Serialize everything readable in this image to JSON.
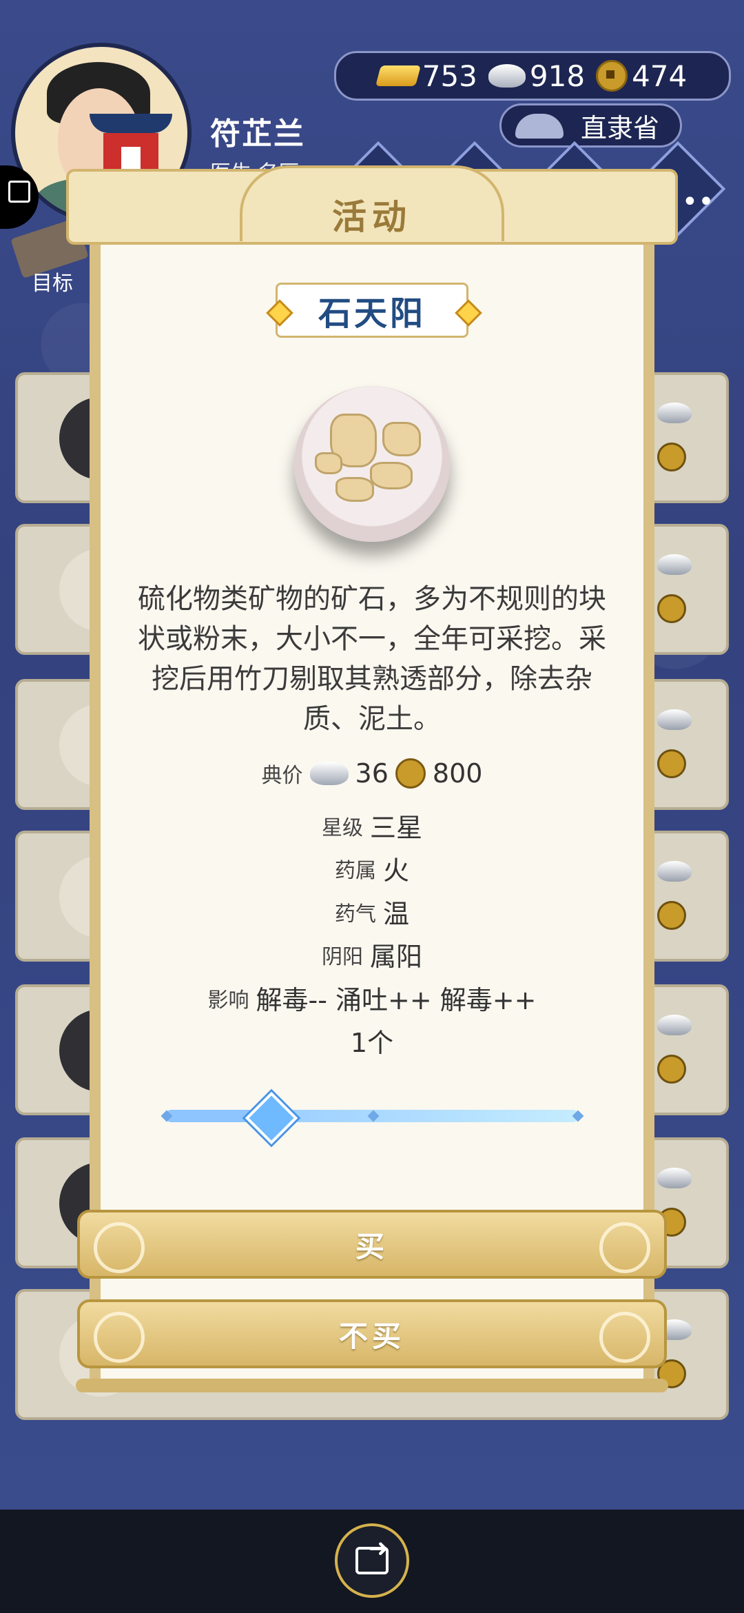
{
  "player": {
    "name": "符芷兰",
    "title": "医生·名医"
  },
  "currency": {
    "gold": "753",
    "silver": "918",
    "coins": "474"
  },
  "region": "直隶省",
  "goal_label": "目标",
  "modal": {
    "title": "活动",
    "item_name": "石天阳",
    "description": "硫化物类矿物的矿石，多为不规则的块状或粉末，大小不一，全年可采挖。采挖后用竹刀剔取其熟透部分，除去杂质、泥土。",
    "price_label": "典价",
    "price_silver": "36",
    "price_coin": "800",
    "star_label": "星级",
    "star_value": "三星",
    "attr_label": "药属",
    "attr_value": "火",
    "qi_label": "药气",
    "qi_value": "温",
    "yinyang_label": "阴阳",
    "yinyang_value": "属阳",
    "effect_label": "影响",
    "effect_value": "解毒-- 涌吐++ 解毒++",
    "quantity": "1个",
    "quantity_slider_fraction": 0.25,
    "buy_label": "买",
    "no_buy_label": "不买"
  }
}
